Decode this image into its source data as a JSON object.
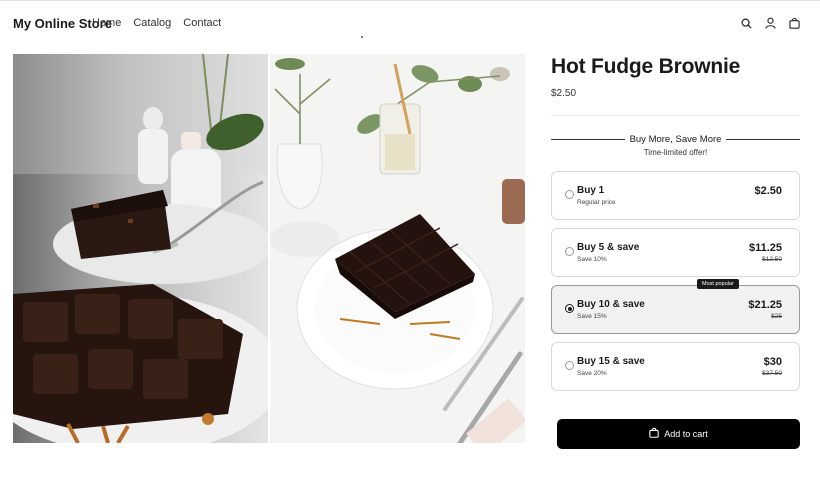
{
  "header": {
    "brand": "My Online Store",
    "nav": [
      "Home",
      "Catalog",
      "Contact"
    ],
    "icons": [
      "search-icon",
      "account-icon",
      "bag-icon"
    ]
  },
  "gallery": {
    "images": [
      "brownie-on-fork-photo",
      "brownie-plate-with-fork-photo"
    ]
  },
  "product": {
    "title": "Hot Fudge Brownie",
    "price": "$2.50"
  },
  "bundle": {
    "heading": "Buy More, Save More",
    "subheading": "Time-limited offer!",
    "badge": "Most popular",
    "options": [
      {
        "name": "Buy 1",
        "sub": "Regular price",
        "price": "$2.50",
        "compare": "",
        "selected": false
      },
      {
        "name": "Buy 5 & save",
        "sub": "Save 10%",
        "price": "$11.25",
        "compare": "$12.50",
        "selected": false
      },
      {
        "name": "Buy 10 & save",
        "sub": "Save 15%",
        "price": "$21.25",
        "compare": "$25",
        "selected": true
      },
      {
        "name": "Buy 15 & save",
        "sub": "Save 20%",
        "price": "$30",
        "compare": "$37.50",
        "selected": false
      }
    ]
  },
  "cart": {
    "label": "Add to cart",
    "icon": "bag-icon"
  },
  "colors": {
    "button": "#000000",
    "selected_bg": "#f1f1f1",
    "text": "#1a1a1a"
  }
}
